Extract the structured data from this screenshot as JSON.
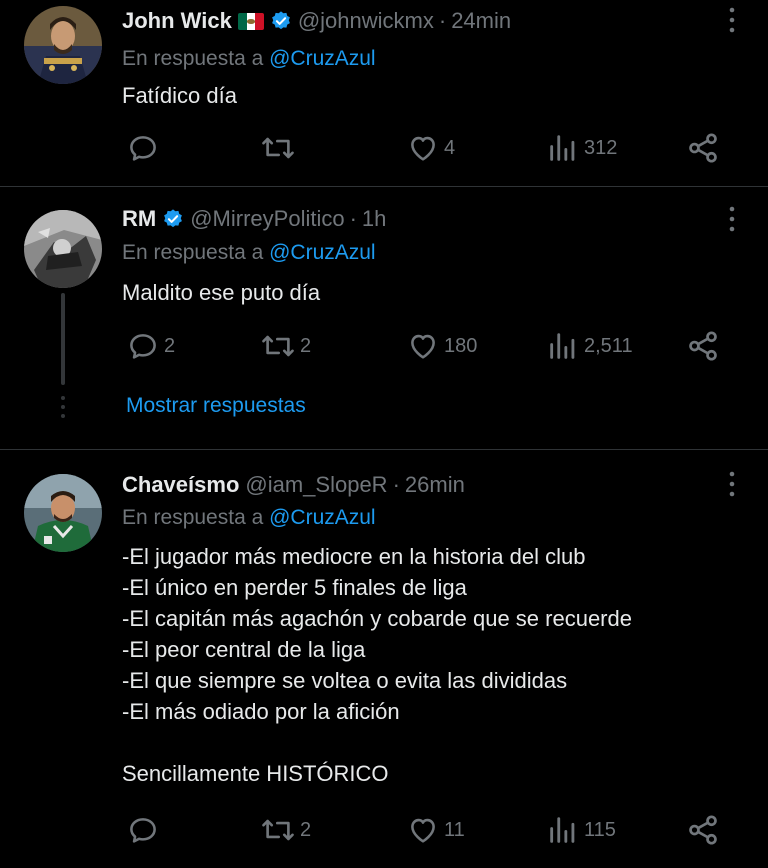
{
  "tweets": [
    {
      "name": "John Wick",
      "handle": "@johnwickmx",
      "time": "24min",
      "reply_prefix": "En respuesta a ",
      "reply_mention": "@CruzAzul",
      "text": "Fatídico día",
      "stats": {
        "replies": "",
        "retweets": "",
        "likes": "4",
        "views": "312"
      },
      "has_flag": true,
      "verified": true
    },
    {
      "name": "RM",
      "handle": "@MirreyPolitico",
      "time": "1h",
      "reply_prefix": "En respuesta a ",
      "reply_mention": "@CruzAzul",
      "text": "Maldito ese puto día",
      "stats": {
        "replies": "2",
        "retweets": "2",
        "likes": "180",
        "views": "2,511"
      },
      "verified": true
    },
    {
      "name": "Chaveísmo",
      "handle": "@iam_SlopeR",
      "time": "26min",
      "reply_prefix": "En respuesta a ",
      "reply_mention": "@CruzAzul",
      "text": "-El jugador más mediocre en la historia del club\n-El único en perder 5 finales de liga\n-El capitán más agachón y cobarde que se recuerde\n-El peor central de la liga\n-El que siempre se voltea o evita las divididas\n-El más odiado por la afición\n\nSencillamente HISTÓRICO",
      "stats": {
        "replies": "",
        "retweets": "2",
        "likes": "11",
        "views": "115"
      },
      "verified": false
    }
  ],
  "show_replies_label": "Mostrar respuestas",
  "dot_separator": "·",
  "colors": {
    "background": "#000000",
    "text": "#e7e9ea",
    "muted": "#71767b",
    "accent": "#1d9bf0",
    "divider": "#2f3336"
  },
  "icons": [
    "reply-icon",
    "retweet-icon",
    "like-icon",
    "views-icon",
    "share-icon",
    "more-icon",
    "verified-icon"
  ]
}
